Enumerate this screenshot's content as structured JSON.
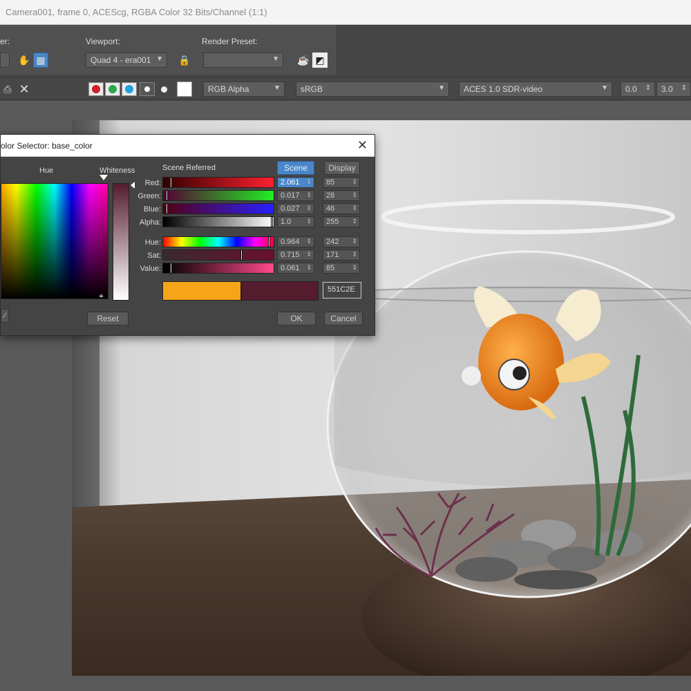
{
  "window": {
    "title": "Camera001, frame 0, ACEScg, RGBA Color 32 Bits/Channel (1:1)"
  },
  "toolbar": {
    "area_label": "er:",
    "viewport_label": "Viewport:",
    "viewport_value": "Quad 4 - era001",
    "render_preset_label": "Render Preset:",
    "render_preset_value": "",
    "channel_value": "RGB Alpha",
    "colorspace_value": "sRGB",
    "display_transform_value": "ACES 1.0 SDR-video",
    "exposure_value": "0.0",
    "gamma_value": "3.0"
  },
  "dialog": {
    "title": "olor Selector: base_color",
    "hue_label": "Hue",
    "whiteness_label": "Whiteness",
    "scene_referred_label": "Scene Referred",
    "scene_tab": "Scene",
    "display_tab": "Display",
    "rows": [
      {
        "label": "Red:",
        "scene": "2.061",
        "display": "85"
      },
      {
        "label": "Green:",
        "scene": "0.017",
        "display": "28"
      },
      {
        "label": "Blue:",
        "scene": "0.027",
        "display": "46"
      },
      {
        "label": "Alpha:",
        "scene": "1.0",
        "display": "255"
      },
      {
        "label": "Hue:",
        "scene": "0.964",
        "display": "242"
      },
      {
        "label": "Sat:",
        "scene": "0.715",
        "display": "171"
      },
      {
        "label": "Value:",
        "scene": "0.061",
        "display": "85"
      }
    ],
    "hex_value": "551C2E",
    "reset_label": "Reset",
    "ok_label": "OK",
    "cancel_label": "Cancel",
    "old_color": "#f7a418",
    "new_color": "#551c2e"
  }
}
